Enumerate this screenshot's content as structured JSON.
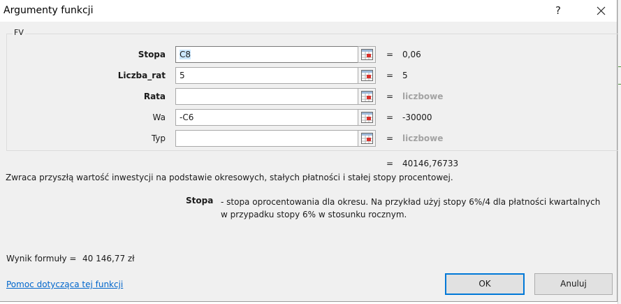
{
  "window": {
    "title": "Argumenty funkcji",
    "help_glyph": "?",
    "close_icon": "close-icon"
  },
  "function_name": "FV",
  "arguments": [
    {
      "label": "Stopa",
      "value": "C8",
      "result": "0,06",
      "bold": true,
      "placeholder_result": false
    },
    {
      "label": "Liczba_rat",
      "value": "5",
      "result": "5",
      "bold": true,
      "placeholder_result": false
    },
    {
      "label": "Rata",
      "value": "",
      "result": "liczbowe",
      "bold": true,
      "placeholder_result": true
    },
    {
      "label": "Wa",
      "value": "-C6",
      "result": "-30000",
      "bold": false,
      "placeholder_result": false
    },
    {
      "label": "Typ",
      "value": "",
      "result": "liczbowe",
      "bold": false,
      "placeholder_result": true
    }
  ],
  "equals_sign": "=",
  "function_result": "40146,76733",
  "description": "Zwraca przyszłą wartość inwestycji na podstawie okresowych, stałych płatności i stałej stopy procentowej.",
  "argument_help": {
    "name": "Stopa",
    "text": "- stopa oprocentowania dla okresu. Na przykład użyj stopy 6%/4 dla płatności kwartalnych w przypadku stopy 6% w stosunku rocznym."
  },
  "formula_result": {
    "label": "Wynik formuły =",
    "value": "40 146,77 zł"
  },
  "help_link": "Pomoc dotycząca tej funkcji",
  "buttons": {
    "ok": "OK",
    "cancel": "Anuluj"
  },
  "colors": {
    "dialog_bg": "#f0f0f0",
    "link": "#0066cc",
    "ok_border": "#0078d7",
    "placeholder": "#a3a3a3",
    "selection": "#cce8ff"
  }
}
